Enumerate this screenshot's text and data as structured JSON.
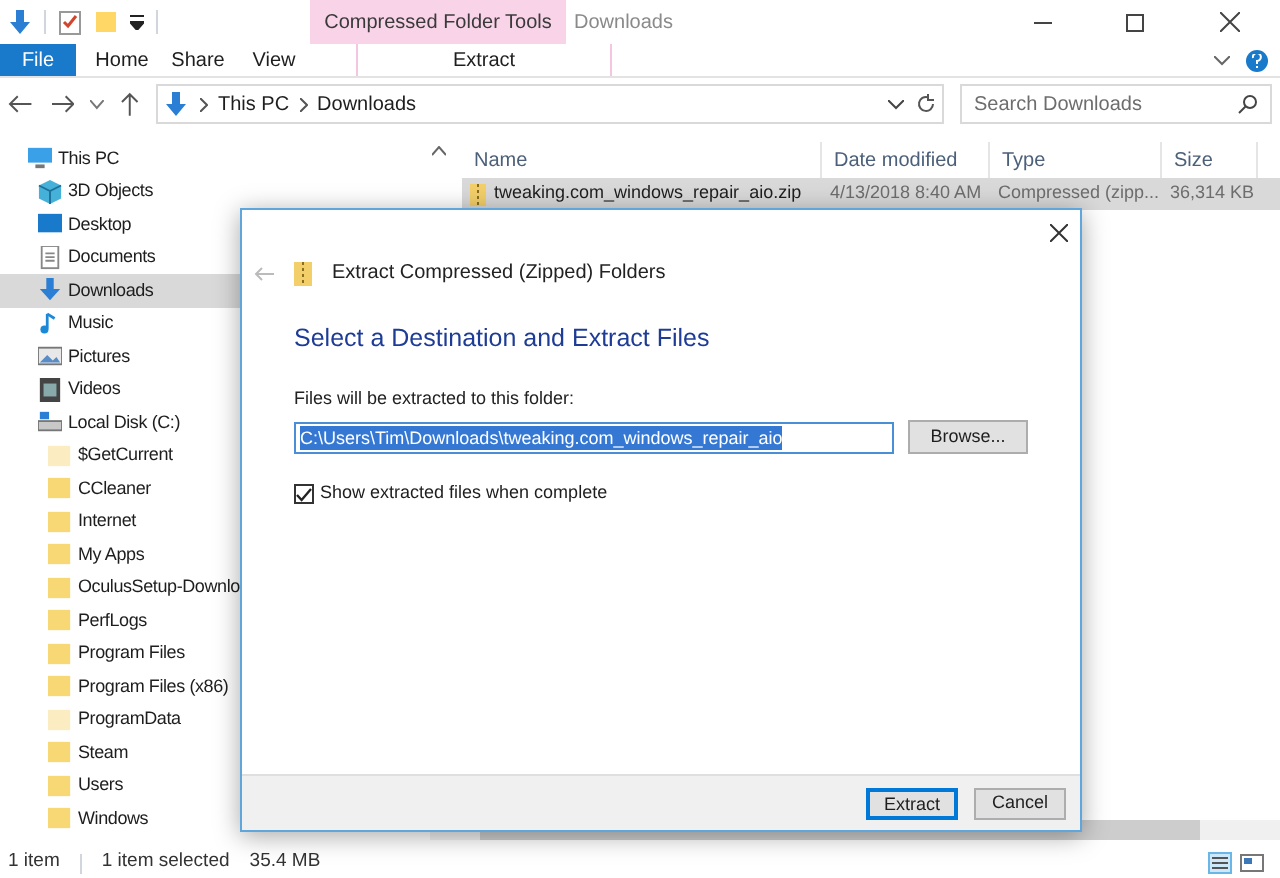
{
  "ribbon": {
    "context_tab": "Compressed Folder Tools",
    "title": "Downloads",
    "tabs": [
      {
        "label": "File",
        "kind": "file",
        "selected": false
      },
      {
        "label": "Home",
        "kind": "normal",
        "selected": false
      },
      {
        "label": "Share",
        "kind": "normal",
        "selected": false
      },
      {
        "label": "View",
        "kind": "normal",
        "selected": false
      },
      {
        "label": "Extract",
        "kind": "context",
        "selected": false
      }
    ]
  },
  "address": {
    "crumbs": [
      "This PC",
      "Downloads"
    ],
    "search_placeholder": "Search Downloads"
  },
  "nav": [
    {
      "label": "This PC",
      "kind": "pc",
      "selected": false,
      "children": [
        {
          "label": "3D Objects",
          "kind": "cube",
          "selected": false
        },
        {
          "label": "Desktop",
          "kind": "desktop",
          "selected": false
        },
        {
          "label": "Documents",
          "kind": "doc",
          "selected": false
        },
        {
          "label": "Downloads",
          "kind": "down",
          "selected": true
        },
        {
          "label": "Music",
          "kind": "music",
          "selected": false
        },
        {
          "label": "Pictures",
          "kind": "pic",
          "selected": false
        },
        {
          "label": "Videos",
          "kind": "video",
          "selected": false
        },
        {
          "label": "Local Disk (C:)",
          "kind": "disk",
          "selected": false,
          "children": [
            {
              "label": "$GetCurrent",
              "kind": "hidden",
              "selected": false
            },
            {
              "label": "CCleaner",
              "kind": "folder",
              "selected": false
            },
            {
              "label": "Internet",
              "kind": "folder",
              "selected": false
            },
            {
              "label": "My Apps",
              "kind": "folder",
              "selected": false
            },
            {
              "label": "OculusSetup-Downlo",
              "kind": "folder",
              "selected": false
            },
            {
              "label": "PerfLogs",
              "kind": "folder",
              "selected": false
            },
            {
              "label": "Program Files",
              "kind": "folder",
              "selected": false
            },
            {
              "label": "Program Files (x86)",
              "kind": "folder",
              "selected": false
            },
            {
              "label": "ProgramData",
              "kind": "hidden",
              "selected": false
            },
            {
              "label": "Steam",
              "kind": "folder",
              "selected": false
            },
            {
              "label": "Users",
              "kind": "folder",
              "selected": false
            },
            {
              "label": "Windows",
              "kind": "folder",
              "selected": false
            }
          ]
        }
      ]
    }
  ],
  "files": {
    "columns": [
      "Name",
      "Date modified",
      "Type",
      "Size"
    ],
    "rows": [
      {
        "name": "tweaking.com_windows_repair_aio.zip",
        "date": "4/13/2018 8:40 AM",
        "type": "Compressed (zipp...",
        "size": "36,314 KB",
        "selected": true
      }
    ]
  },
  "dialog": {
    "title": "Extract Compressed (Zipped) Folders",
    "heading": "Select a Destination and Extract Files",
    "field_label": "Files will be extracted to this folder:",
    "path": "C:\\Users\\Tim\\Downloads\\tweaking.com_windows_repair_aio",
    "browse": "Browse...",
    "checkbox": {
      "label": "Show extracted files when complete",
      "checked": true
    },
    "buttons": [
      {
        "label": "Extract",
        "kind": "default"
      },
      {
        "label": "Cancel",
        "kind": "normal"
      }
    ]
  },
  "status_bar": {
    "count": "1 item",
    "selection": "1 item selected",
    "size": "35.4 MB"
  }
}
